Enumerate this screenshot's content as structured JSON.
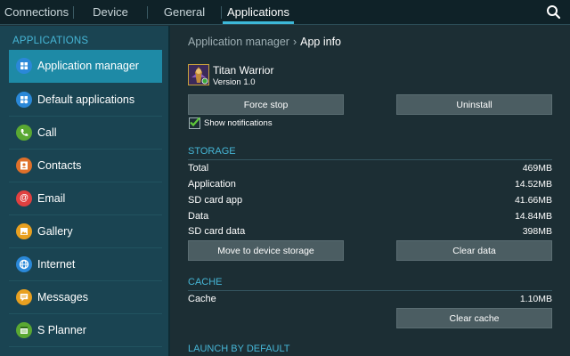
{
  "tabs": [
    {
      "label": "Connections"
    },
    {
      "label": "Device"
    },
    {
      "label": "General"
    },
    {
      "label": "Applications"
    }
  ],
  "sidebar": {
    "heading": "APPLICATIONS",
    "items": [
      {
        "label": "Application manager",
        "icon": "grid-icon",
        "color": "#2a88d8"
      },
      {
        "label": "Default applications",
        "icon": "apps-icon",
        "color": "#2a88d8"
      },
      {
        "label": "Call",
        "icon": "phone-icon",
        "color": "#5aa832"
      },
      {
        "label": "Contacts",
        "icon": "contacts-icon",
        "color": "#e0702a"
      },
      {
        "label": "Email",
        "icon": "email-icon",
        "color": "#e04040"
      },
      {
        "label": "Gallery",
        "icon": "gallery-icon",
        "color": "#e8a020"
      },
      {
        "label": "Internet",
        "icon": "internet-icon",
        "color": "#2a88d8"
      },
      {
        "label": "Messages",
        "icon": "messages-icon",
        "color": "#e8a020"
      },
      {
        "label": "S Planner",
        "icon": "planner-icon",
        "color": "#5aa832"
      }
    ]
  },
  "breadcrumb": {
    "parent": "Application manager",
    "current": "App info"
  },
  "app": {
    "name": "Titan Warrior",
    "version": "Version 1.0"
  },
  "buttons": {
    "force_stop": "Force stop",
    "uninstall": "Uninstall",
    "move_storage": "Move to device storage",
    "clear_data": "Clear data",
    "clear_cache": "Clear cache"
  },
  "notifications": {
    "label": "Show notifications",
    "checked": true
  },
  "storage": {
    "title": "STORAGE",
    "rows": [
      {
        "label": "Total",
        "value": "469MB"
      },
      {
        "label": "Application",
        "value": "14.52MB"
      },
      {
        "label": "SD card app",
        "value": "41.66MB"
      },
      {
        "label": "Data",
        "value": "14.84MB"
      },
      {
        "label": "SD card data",
        "value": "398MB"
      }
    ]
  },
  "cache": {
    "title": "CACHE",
    "rows": [
      {
        "label": "Cache",
        "value": "1.10MB"
      }
    ]
  },
  "launch": {
    "title": "LAUNCH BY DEFAULT"
  },
  "colors": {
    "accent": "#46b6d6",
    "selected": "#1e8aa6",
    "button": "#4b5d62"
  }
}
